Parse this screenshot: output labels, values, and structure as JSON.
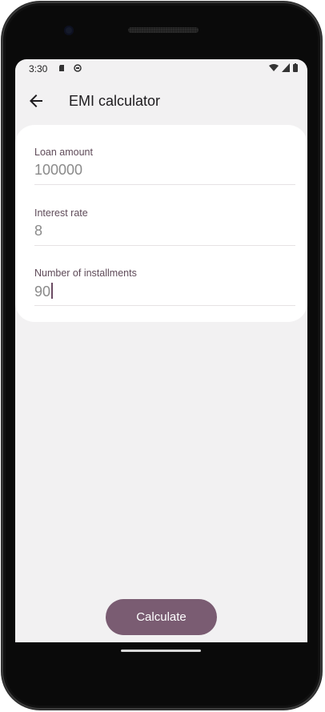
{
  "status": {
    "time": "3:30"
  },
  "appbar": {
    "title": "EMI calculator"
  },
  "form": {
    "loan_amount": {
      "label": "Loan amount",
      "value": "100000"
    },
    "interest_rate": {
      "label": "Interest rate",
      "value": "8"
    },
    "installments": {
      "label": "Number of installments",
      "value": "90"
    }
  },
  "actions": {
    "calculate_label": "Calculate"
  },
  "colors": {
    "primary": "#7a5c72",
    "label": "#5f4b59",
    "background": "#f2f1f2",
    "card": "#ffffff"
  },
  "icons": [
    "back-arrow-icon",
    "sd-card-icon",
    "face-icon",
    "wifi-icon",
    "signal-icon",
    "battery-icon"
  ]
}
